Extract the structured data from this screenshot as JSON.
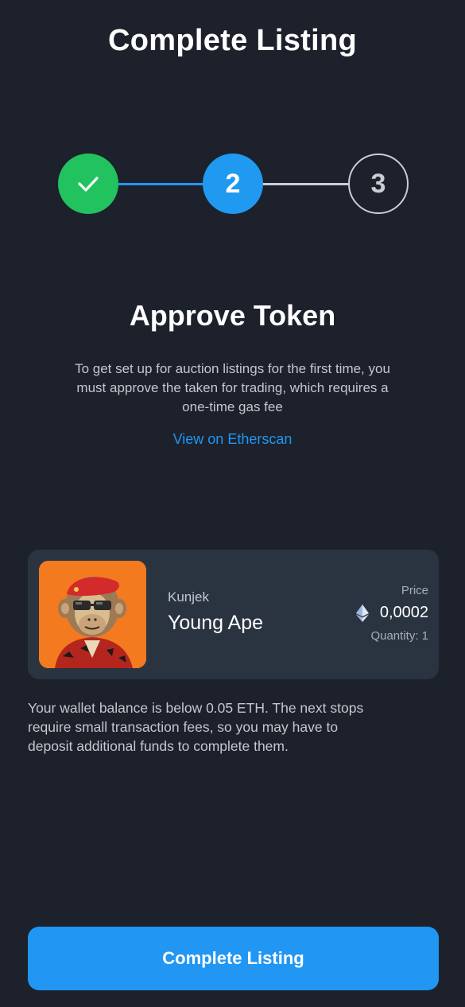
{
  "header": {
    "title": "Complete Listing"
  },
  "stepper": {
    "steps": [
      {
        "label": "",
        "state": "completed",
        "icon": "check-icon"
      },
      {
        "label": "2",
        "state": "active"
      },
      {
        "label": "3",
        "state": "upcoming"
      }
    ],
    "colors": {
      "completed": "#22c35e",
      "active": "#1f9af0",
      "upcoming": "#c9ced6"
    }
  },
  "approve": {
    "title": "Approve Token",
    "description_lines": [
      "To get set up for auction listings for the first time, you",
      "must approve the taken for trading, which requires a",
      "one-time gas fee"
    ],
    "link_label": "View on Etherscan"
  },
  "item": {
    "collection": "Kunjek",
    "name": "Young Ape",
    "price_label": "Price",
    "price": "0,0002",
    "price_icon": "ethereum-icon",
    "quantity": "Quantity: 1",
    "image": "bored-ape-avatar"
  },
  "warning": {
    "lines": [
      "Your wallet balance is below 0.05 ETH. The next stops",
      "require small transaction fees, so you may have to",
      "deposit additional funds to complete them."
    ]
  },
  "footer": {
    "button_label": "Complete Listing",
    "accent": "#2196f3"
  }
}
